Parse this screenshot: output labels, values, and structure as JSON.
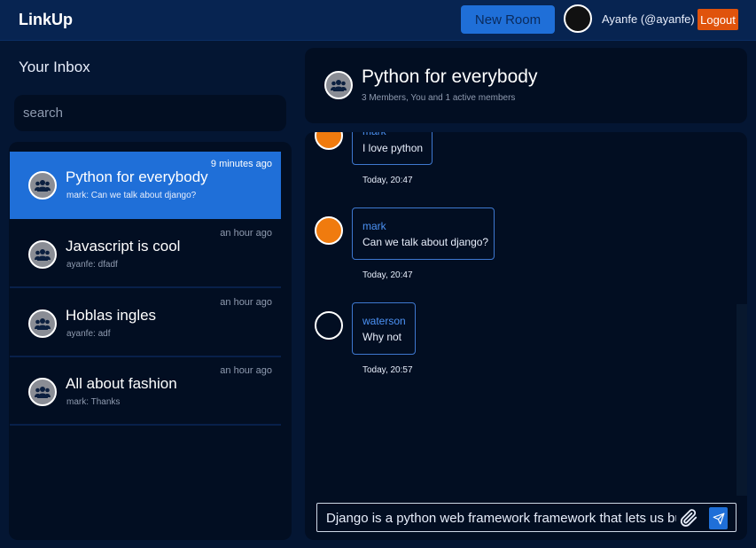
{
  "app": {
    "title": "LinkUp"
  },
  "header": {
    "new_room_label": "New Room",
    "user_label": "Ayanfe (@ayanfe)",
    "logout_label": "Logout"
  },
  "inbox": {
    "title": "Your Inbox",
    "search_placeholder": "search",
    "conversations": [
      {
        "title": "Python for everybody",
        "preview": "mark: Can we talk about django?",
        "time": "9 minutes ago",
        "active": true
      },
      {
        "title": "Javascript is cool",
        "preview": "ayanfe: dfadf",
        "time": "an hour ago",
        "active": false
      },
      {
        "title": "Hoblas ingles",
        "preview": "ayanfe: adf",
        "time": "an hour ago",
        "active": false
      },
      {
        "title": "All about fashion",
        "preview": "mark: Thanks",
        "time": "an hour ago",
        "active": false
      }
    ]
  },
  "room": {
    "title": "Python for everybody",
    "subtitle": "3 Members, You and 1 active members",
    "messages": [
      {
        "sender": "mark",
        "text": "I love python",
        "time": "Today, 20:47"
      },
      {
        "sender": "mark",
        "text": "Can we talk about django?",
        "time": "Today, 20:47"
      },
      {
        "sender": "waterson",
        "text": "Why not",
        "time": "Today, 20:57"
      }
    ]
  },
  "composer": {
    "value": "Django is a python web framework framework that lets us build"
  },
  "icons": {
    "group": "users-group-icon",
    "attach": "paperclip-icon",
    "send": "paper-plane-icon"
  },
  "colors": {
    "accent": "#1f6fd8",
    "logout": "#e0530c",
    "avatar_orange": "#f07b0e",
    "background": "#041633",
    "panel": "#020e22"
  }
}
